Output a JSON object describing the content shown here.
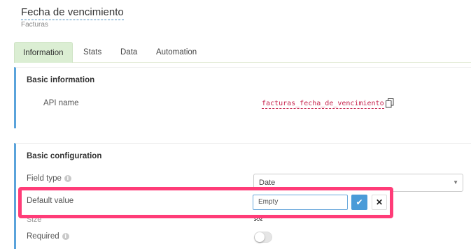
{
  "header": {
    "title": "Fecha de vencimiento",
    "subtitle": "Facturas"
  },
  "tabs": [
    {
      "label": "Information",
      "active": true
    },
    {
      "label": "Stats",
      "active": false
    },
    {
      "label": "Data",
      "active": false
    },
    {
      "label": "Automation",
      "active": false
    }
  ],
  "basic_information": {
    "title": "Basic information",
    "api_name_label": "API name",
    "api_name_value": "facturas_fecha_de_vencimiento",
    "copy_icon": "copy-icon"
  },
  "basic_configuration": {
    "title": "Basic configuration",
    "field_type_label": "Field type",
    "field_type_value": "Date",
    "default_value_label": "Default value",
    "default_value_input": "Empty",
    "size_label": "Size",
    "size_value": "50",
    "required_label": "Required",
    "required_on": false
  },
  "colors": {
    "accent": "#5aa3db",
    "active_tab": "#dbeed3",
    "highlight": "#ff3c78",
    "code": "#c7254e",
    "confirm_button": "#4a9bd8"
  }
}
